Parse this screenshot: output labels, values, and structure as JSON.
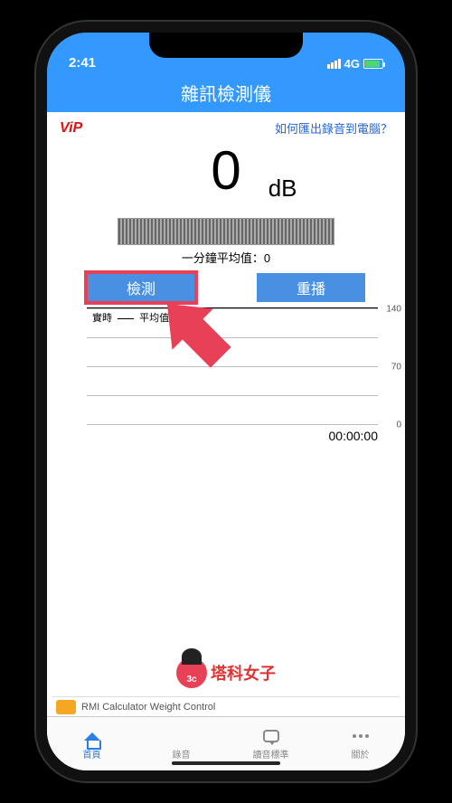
{
  "status": {
    "time": "2:41",
    "network": "4G"
  },
  "nav": {
    "title": "雜訊檢測儀"
  },
  "top": {
    "vip": "ViP",
    "help_link": "如何匯出錄音到電腦？"
  },
  "reading": {
    "value": "0",
    "unit": "dB"
  },
  "avg": {
    "label": "一分鐘平均值：0"
  },
  "buttons": {
    "detect": "檢測",
    "replay": "重播"
  },
  "chart_data": {
    "type": "line",
    "series": [
      {
        "name": "實時",
        "values": []
      },
      {
        "name": "平均值",
        "values": []
      }
    ],
    "ylim": [
      0,
      140
    ],
    "yticks": [
      0,
      70,
      140
    ],
    "xlabel": "",
    "ylabel": "",
    "legend_labels": {
      "realtime": "實時",
      "avg": "平均值"
    }
  },
  "timer": {
    "value": "00:00:00"
  },
  "watermark": {
    "text": "塔科女子"
  },
  "banner": {
    "text": "RMI Calculator  Weight Control"
  },
  "tabs": {
    "home": "首頁",
    "record": "錄音",
    "standard": "讀音標準",
    "about": "關於"
  }
}
